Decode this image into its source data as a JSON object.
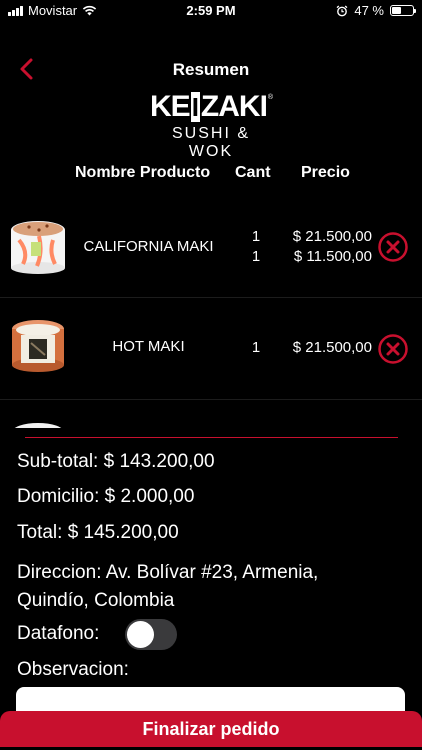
{
  "status_bar": {
    "carrier": "Movistar",
    "time": "2:59 PM",
    "battery": "47 %",
    "battery_level": 0.47
  },
  "header": {
    "title": "Resumen"
  },
  "logo": {
    "brand_left": "KE",
    "brand_box": "I",
    "brand_right": "ZAKI",
    "registered": "®",
    "tagline": "SUSHI & WOK"
  },
  "table": {
    "col_product": "Nombre Producto",
    "col_qty": "Cant",
    "col_price": "Precio"
  },
  "products": [
    {
      "name": "CALIFORNIA MAKI",
      "qty_1": "1",
      "qty_2": "1",
      "price_1": "$ 21.500,00",
      "price_2": "$ 11.500,00"
    },
    {
      "name": "HOT MAKI",
      "qty_1": "1",
      "price_1": "$ 21.500,00"
    }
  ],
  "summary": {
    "subtotal": "Sub-total: $ 143.200,00",
    "delivery": "Domicilio: $ 2.000,00",
    "total": "Total: $ 145.200,00",
    "address": "Direccion: Av. Bolívar #23, Armenia, Quindío, Colombia",
    "datafono_label": "Datafono:",
    "datafono_on": false,
    "observation_label": "Observacion:",
    "observation_value": ""
  },
  "actions": {
    "finish": "Finalizar pedido"
  },
  "colors": {
    "accent": "#c8102e",
    "background": "#000000"
  }
}
